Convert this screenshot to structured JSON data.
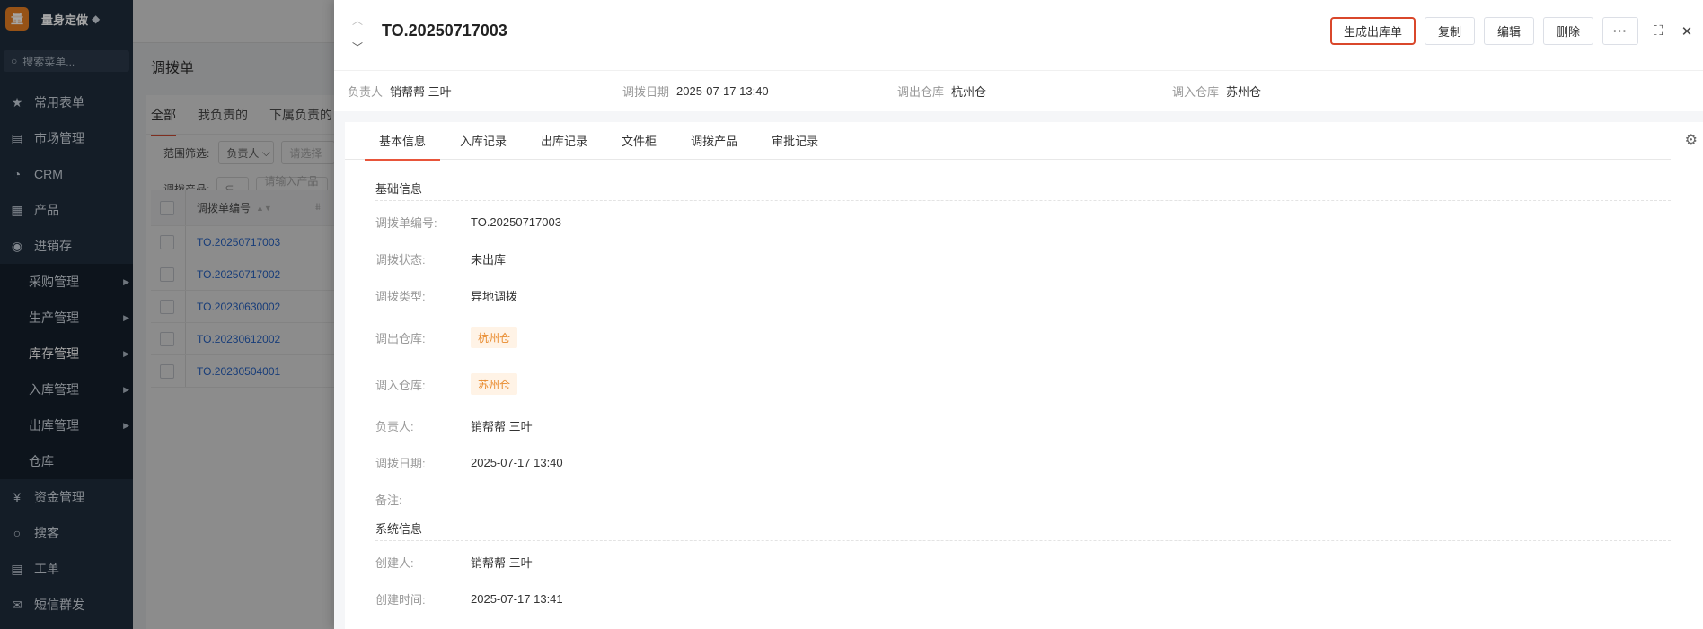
{
  "sidebar": {
    "brand": "量身定做",
    "search_placeholder": "搜索菜单...",
    "items": [
      {
        "label": "常用表单",
        "icon": "star-icon"
      },
      {
        "label": "市场管理",
        "icon": "clipboard-icon"
      },
      {
        "label": "CRM",
        "icon": "pie-icon"
      },
      {
        "label": "产品",
        "icon": "grid-icon"
      },
      {
        "label": "进销存",
        "icon": "cycle-icon"
      }
    ],
    "sub_items": [
      {
        "label": "采购管理"
      },
      {
        "label": "生产管理"
      },
      {
        "label": "库存管理"
      },
      {
        "label": "入库管理"
      },
      {
        "label": "出库管理"
      },
      {
        "label": "仓库"
      }
    ],
    "bottom_items": [
      {
        "label": "资金管理",
        "icon": "money-icon"
      },
      {
        "label": "搜客",
        "icon": "search-icon"
      },
      {
        "label": "工单",
        "icon": "ticket-icon"
      },
      {
        "label": "短信群发",
        "icon": "mail-icon"
      }
    ]
  },
  "background_page": {
    "title": "调拨单",
    "tabs": [
      "全部",
      "我负责的",
      "下属负责的"
    ],
    "filter1_label": "范围筛选:",
    "filter1_select": "负责人",
    "filter1_input": "请选择",
    "filter2_label": "调拨产品:",
    "filter2_input": "请输入产品名",
    "column_header": "调拨单编号",
    "rows": [
      "TO.20250717003",
      "TO.20250717002",
      "TO.20230630002",
      "TO.20230612002",
      "TO.20230504001"
    ]
  },
  "drawer": {
    "title": "TO.20250717003",
    "actions": {
      "generate": "生成出库单",
      "copy": "复制",
      "edit": "编辑",
      "delete": "删除",
      "more": "···"
    },
    "summary": [
      {
        "label": "负责人",
        "value": "销帮帮 三叶"
      },
      {
        "label": "调拨日期",
        "value": "2025-07-17 13:40"
      },
      {
        "label": "调出仓库",
        "value": "杭州仓"
      },
      {
        "label": "调入仓库",
        "value": "苏州仓"
      }
    ],
    "tabs": [
      "基本信息",
      "入库记录",
      "出库记录",
      "文件柜",
      "调拨产品",
      "审批记录"
    ],
    "section_basic": "基础信息",
    "fields": {
      "code": {
        "label": "调拨单编号:",
        "value": "TO.20250717003"
      },
      "status": {
        "label": "调拨状态:",
        "value": "未出库"
      },
      "type": {
        "label": "调拨类型:",
        "value": "异地调拨"
      },
      "out_wh": {
        "label": "调出仓库:",
        "value": "杭州仓"
      },
      "in_wh": {
        "label": "调入仓库:",
        "value": "苏州仓"
      },
      "owner": {
        "label": "负责人:",
        "value": "销帮帮 三叶"
      },
      "date": {
        "label": "调拨日期:",
        "value": "2025-07-17 13:40"
      },
      "remark": {
        "label": "备注:",
        "value": ""
      }
    },
    "section_system": "系统信息",
    "system_fields": {
      "creator": {
        "label": "创建人:",
        "value": "销帮帮 三叶"
      },
      "created": {
        "label": "创建时间:",
        "value": "2025-07-17 13:41"
      }
    }
  }
}
